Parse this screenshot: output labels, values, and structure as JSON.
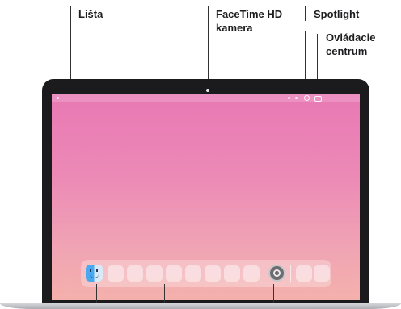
{
  "callouts": {
    "menu_bar": "Lišta",
    "camera_line1": "FaceTime HD",
    "camera_line2": "kamera",
    "spotlight": "Spotlight",
    "control_center_line1": "Ovládacie",
    "control_center_line2": "centrum"
  },
  "icons": {
    "camera": "camera-dot-icon",
    "spotlight": "search-icon",
    "control_center": "control-center-icon",
    "finder": "finder-icon",
    "system_settings": "gear-icon"
  },
  "colors": {
    "bezel": "#1b1b1d",
    "screen_top": "#e878b4",
    "screen_bottom": "#f4b1ab",
    "leader": "#333333",
    "label": "#1d1d1f"
  }
}
